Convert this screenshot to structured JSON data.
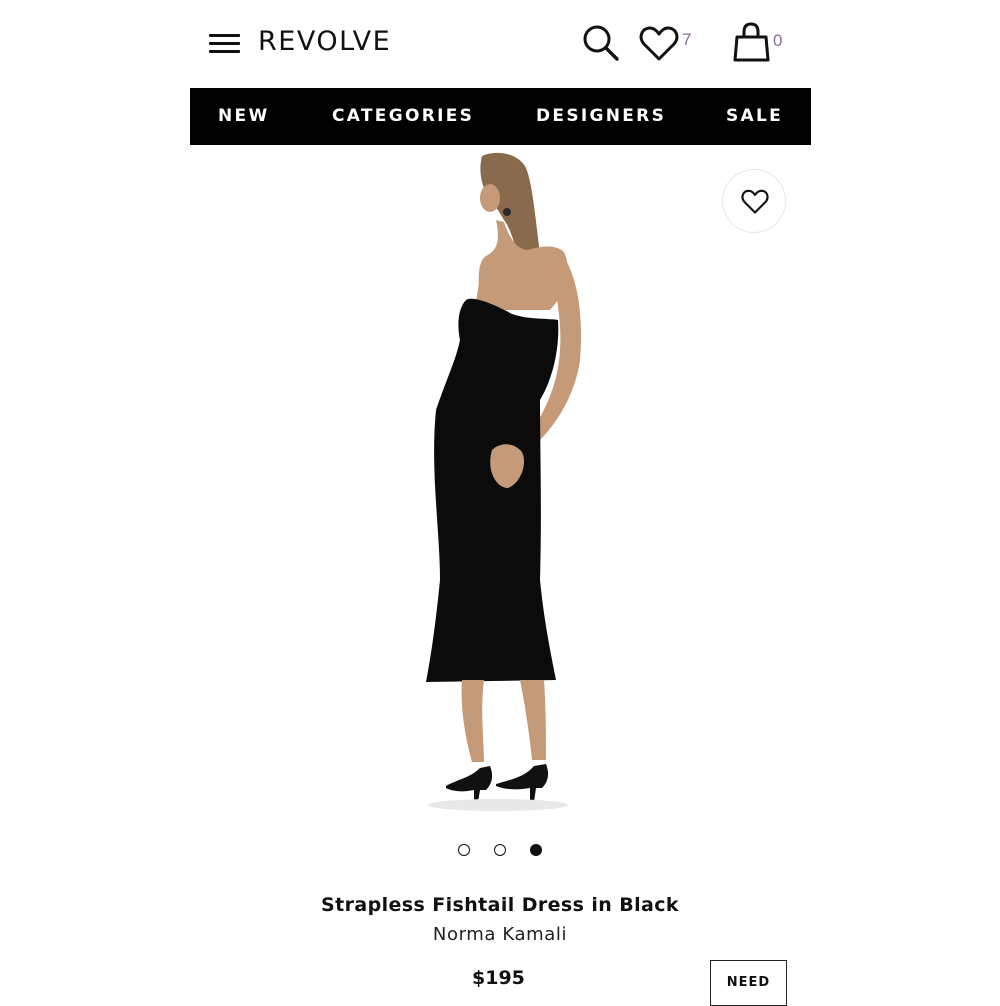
{
  "header": {
    "menu_icon": "hamburger-menu-icon",
    "logo_text": "REVOLVE",
    "search_icon": "search-icon",
    "wishlist_icon": "heart-icon",
    "wishlist_count": "7",
    "bag_icon": "shopping-bag-icon",
    "bag_count": "0",
    "count_color": "#8e6b98"
  },
  "nav": {
    "items": [
      {
        "label": "NEW"
      },
      {
        "label": "CATEGORIES"
      },
      {
        "label": "DESIGNERS"
      },
      {
        "label": "SALE"
      }
    ],
    "background": "#000000",
    "text_color": "#ffffff"
  },
  "gallery": {
    "favorite_icon": "heart-outline-icon",
    "image_count": 3,
    "active_index": 3
  },
  "product": {
    "name": "Strapless Fishtail Dress in Black",
    "designer": "Norma Kamali",
    "price": "$195",
    "need_button_label": "NEED"
  }
}
